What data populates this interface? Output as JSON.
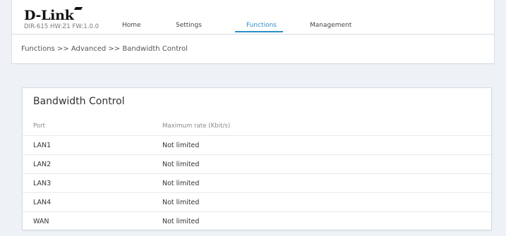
{
  "header": {
    "logo": "D-Link",
    "model": "DIR-615  HW:Z1  FW:1.0.0",
    "nav": [
      {
        "label": "Home"
      },
      {
        "label": "Settings"
      },
      {
        "label": "Functions",
        "active": true
      },
      {
        "label": "Management"
      }
    ],
    "accent_color": "#2b8fc7"
  },
  "breadcrumb": "Functions >> Advanced >> Bandwidth Control",
  "panel": {
    "title": "Bandwidth Control",
    "columns": [
      "Port",
      "Maximum rate (Kbit/s)"
    ],
    "rows": [
      {
        "port": "LAN1",
        "rate": "Not limited"
      },
      {
        "port": "LAN2",
        "rate": "Not limited"
      },
      {
        "port": "LAN3",
        "rate": "Not limited"
      },
      {
        "port": "LAN4",
        "rate": "Not limited"
      },
      {
        "port": "WAN",
        "rate": "Not limited"
      }
    ]
  }
}
